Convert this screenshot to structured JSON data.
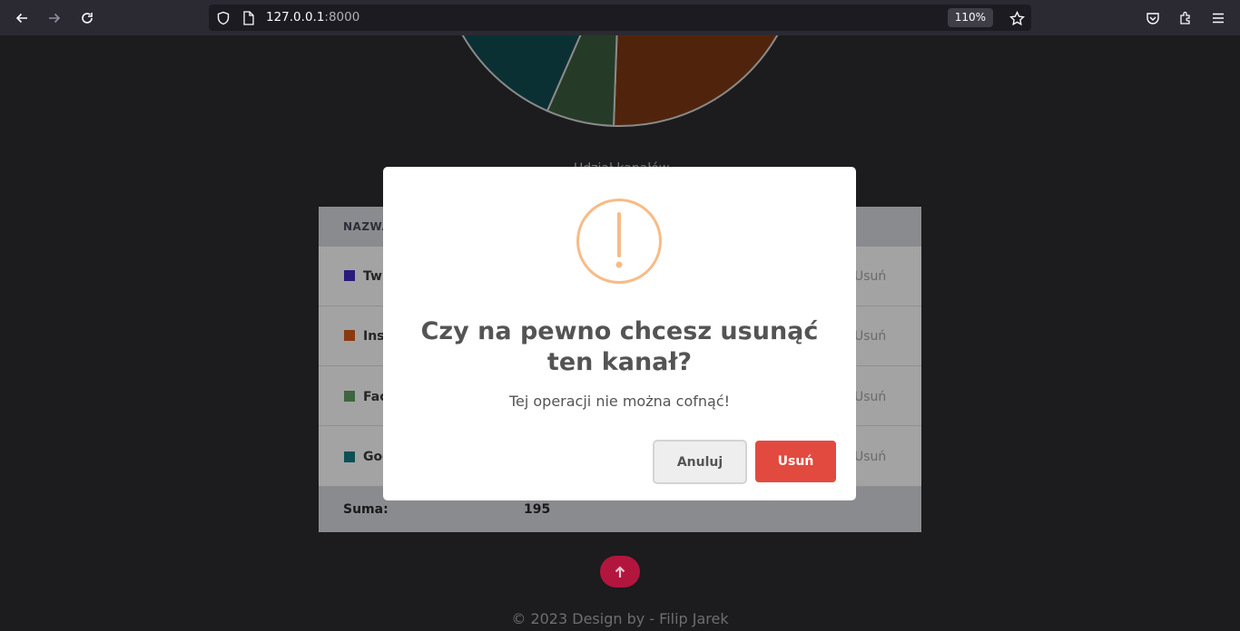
{
  "browser": {
    "url_host": "127.0.0.1",
    "url_port": ":8000",
    "zoom": "110%"
  },
  "chart_data": {
    "type": "pie",
    "slices": [
      {
        "name": "Twitter",
        "color": "#2a1a7a"
      },
      {
        "name": "Instagram",
        "color": "#8a3a0f",
        "visible_fraction": 0.2
      },
      {
        "name": "Facebook",
        "color": "#3f6440",
        "visible_fraction": 0.06
      },
      {
        "name": "Google",
        "color": "#0d5056",
        "visible_fraction": 0.2
      }
    ],
    "bottom_label": "Udział kanałów"
  },
  "table": {
    "header": "NAZWA",
    "rows": [
      {
        "name": "Twitter",
        "color": "#2a1a7a",
        "action": "Usuń"
      },
      {
        "name": "Instagram",
        "color": "#8a3a0f",
        "action": "Usuń"
      },
      {
        "name": "Facebook",
        "color": "#3f6440",
        "action": "Usuń"
      },
      {
        "name": "Google",
        "color": "#0d5056",
        "action": "Usuń"
      }
    ],
    "sum_label": "Suma:",
    "sum_value": "195"
  },
  "footer": "© 2023 Design by - Filip Jarek",
  "modal": {
    "title": "Czy na pewno chcesz usunąć ten kanał?",
    "text": "Tej operacji nie można cofnąć!",
    "cancel_label": "Anuluj",
    "confirm_label": "Usuń",
    "icon": "warning-icon",
    "icon_color": "#f8bb86",
    "confirm_color": "#e24a3f"
  }
}
